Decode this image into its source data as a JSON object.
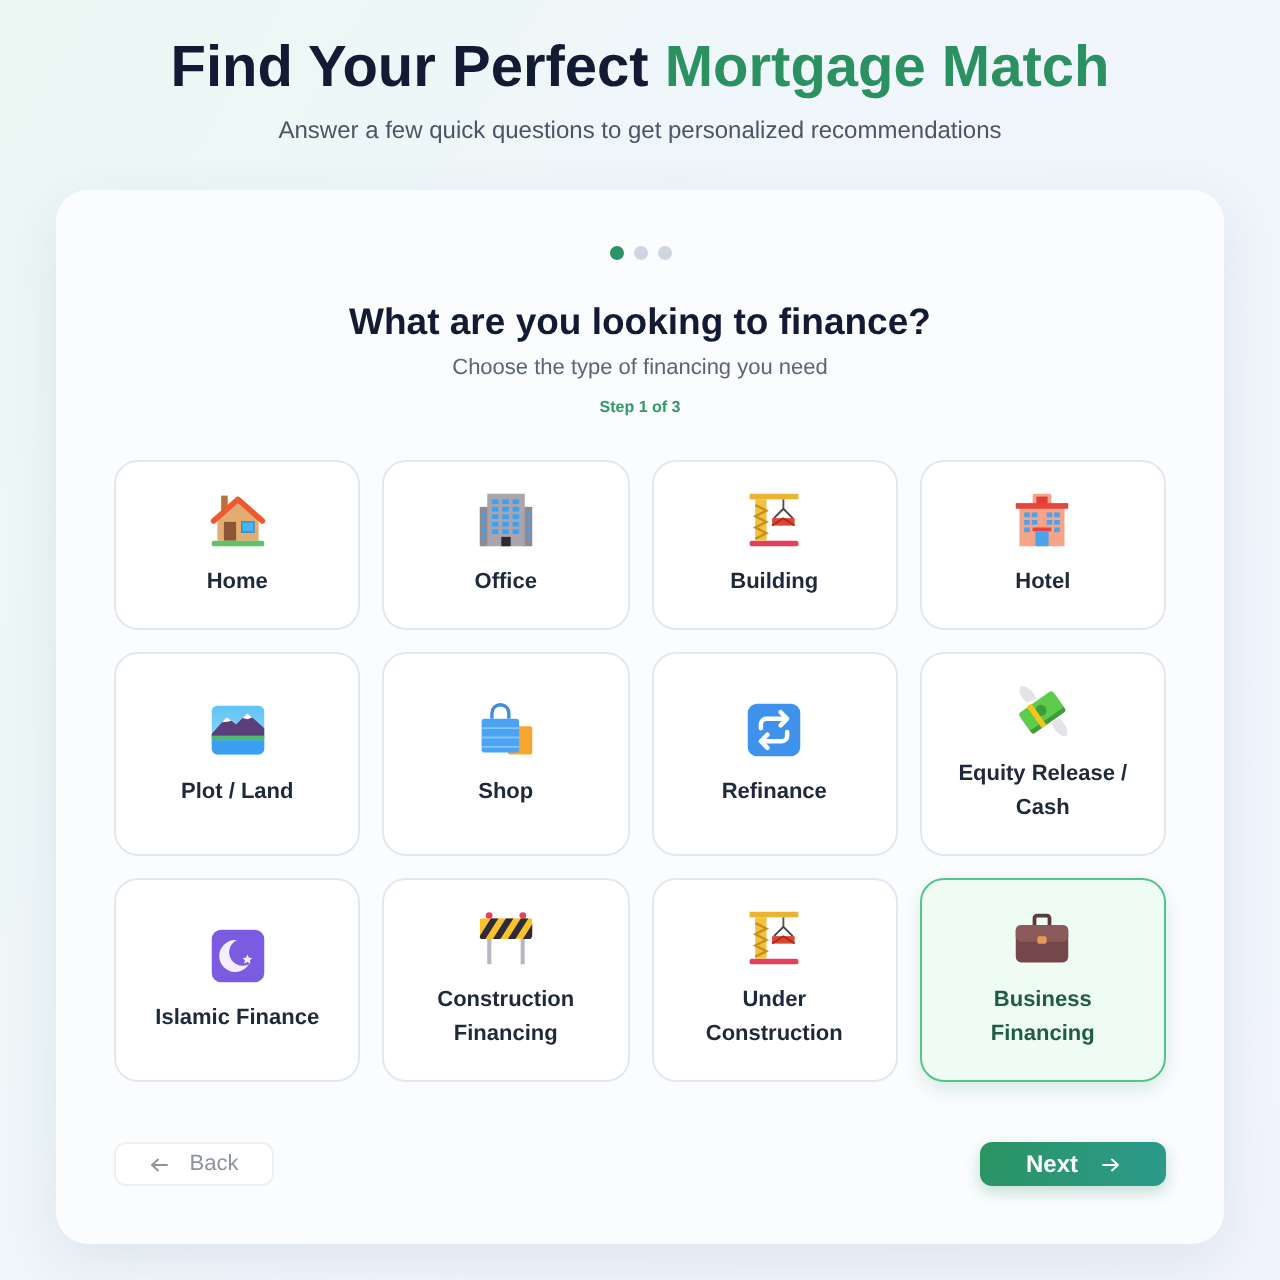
{
  "header": {
    "title": "Find Your Perfect",
    "title_highlight": "Mortgage Match",
    "subtitle": "Answer a few quick questions to get personalized recommendations"
  },
  "wizard": {
    "steps": [
      {
        "selected": true
      },
      {
        "selected": false
      },
      {
        "selected": false
      }
    ],
    "question": "What are you looking to finance?",
    "hint": "Choose the type of financing you need",
    "step_label": "Step 1 of 3",
    "options": [
      {
        "kind": "home",
        "label": "Home",
        "selected": false
      },
      {
        "kind": "office",
        "label": "Office",
        "selected": false
      },
      {
        "kind": "building",
        "label": "Building",
        "selected": false
      },
      {
        "kind": "hotel",
        "label": "Hotel",
        "selected": false
      },
      {
        "kind": "land",
        "label": "Plot / Land",
        "selected": false
      },
      {
        "kind": "shop",
        "label": "Shop",
        "selected": false
      },
      {
        "kind": "refinance",
        "label": "Refinance",
        "selected": false
      },
      {
        "kind": "equity",
        "label": "Equity Release / Cash",
        "selected": false
      },
      {
        "kind": "islamic",
        "label": "Islamic Finance",
        "selected": false
      },
      {
        "kind": "construction",
        "label": "Construction Financing",
        "selected": false
      },
      {
        "kind": "underconstruction",
        "label": "Under Construction",
        "selected": false
      },
      {
        "kind": "business",
        "label": "Business Financing",
        "selected": true
      }
    ],
    "back_button": {
      "label": "Back",
      "disabled": true
    },
    "next_button": {
      "label": "Next"
    }
  }
}
